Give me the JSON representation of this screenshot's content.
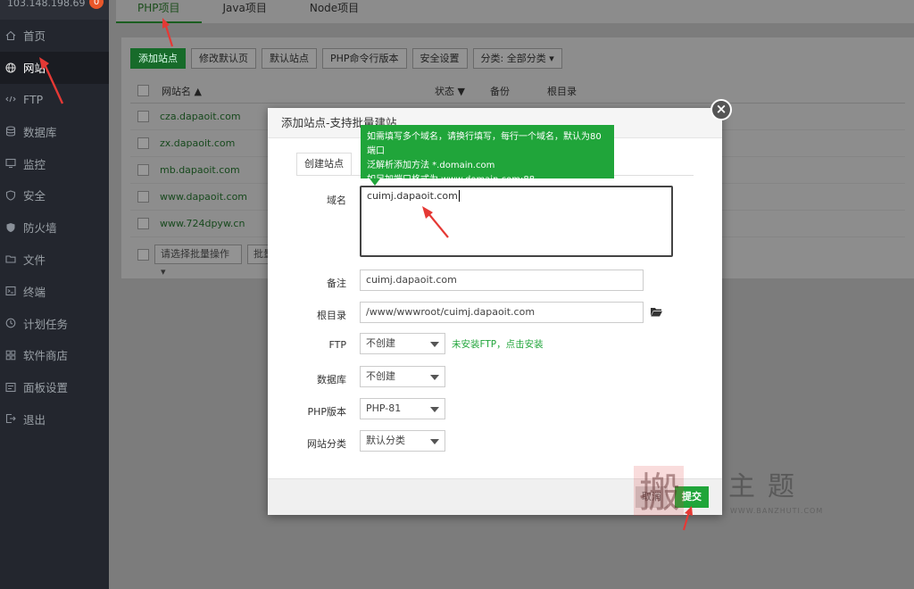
{
  "server": {
    "ip": "103.148.198.69",
    "badge": "0"
  },
  "sidebar": {
    "items": [
      {
        "label": "首页",
        "icon": "home-icon"
      },
      {
        "label": "网站",
        "icon": "globe-icon",
        "active": true
      },
      {
        "label": "FTP",
        "icon": "ftp-icon"
      },
      {
        "label": "数据库",
        "icon": "database-icon"
      },
      {
        "label": "监控",
        "icon": "monitor-icon"
      },
      {
        "label": "安全",
        "icon": "shield-icon"
      },
      {
        "label": "防火墙",
        "icon": "firewall-icon"
      },
      {
        "label": "文件",
        "icon": "folder-icon"
      },
      {
        "label": "终端",
        "icon": "terminal-icon"
      },
      {
        "label": "计划任务",
        "icon": "clock-icon"
      },
      {
        "label": "软件商店",
        "icon": "store-icon"
      },
      {
        "label": "面板设置",
        "icon": "settings-icon"
      },
      {
        "label": "退出",
        "icon": "logout-icon"
      }
    ]
  },
  "tabs": [
    "PHP项目",
    "Java项目",
    "Node项目"
  ],
  "toolbar": {
    "add_site": "添加站点",
    "modify_default": "修改默认页",
    "default_site": "默认站点",
    "php_cli": "PHP命令行版本",
    "security": "安全设置",
    "category": "分类: 全部分类"
  },
  "table": {
    "headers": {
      "name": "网站名",
      "status": "状态",
      "backup": "备份",
      "root": "根目录"
    },
    "rows": [
      "cza.dapaoit.com",
      "zx.dapaoit.com",
      "mb.dapaoit.com",
      "www.dapaoit.com",
      "www.724dpyw.cn"
    ],
    "batch_placeholder": "请选择批量操作",
    "batch_btn": "批量"
  },
  "modal": {
    "title": "添加站点-支持批量建站",
    "tab": "创建站点",
    "labels": {
      "domain": "域名",
      "remark": "备注",
      "root": "根目录",
      "ftp": "FTP",
      "database": "数据库",
      "php": "PHP版本",
      "category": "网站分类"
    },
    "values": {
      "domain": "cuimj.dapaoit.com",
      "remark": "cuimj.dapaoit.com",
      "root": "/www/wwwroot/cuimj.dapaoit.com",
      "ftp": "不创建",
      "database": "不创建",
      "php": "PHP-81",
      "category": "默认分类"
    },
    "ftp_hint": "未安装FTP，点击安装",
    "tooltip": [
      "如需填写多个域名，请换行填写，每行一个域名，默认为80端口",
      "泛解析添加方法 *.domain.com",
      "如另加端口格式为 www.domain.com:88"
    ],
    "cancel": "取消",
    "submit": "提交"
  },
  "watermark": {
    "text": "主题",
    "url": "WWW.BANZHUTI.COM"
  },
  "colors": {
    "accent": "#20a53a",
    "sidebar": "#23262e",
    "arrow": "#e53935"
  }
}
